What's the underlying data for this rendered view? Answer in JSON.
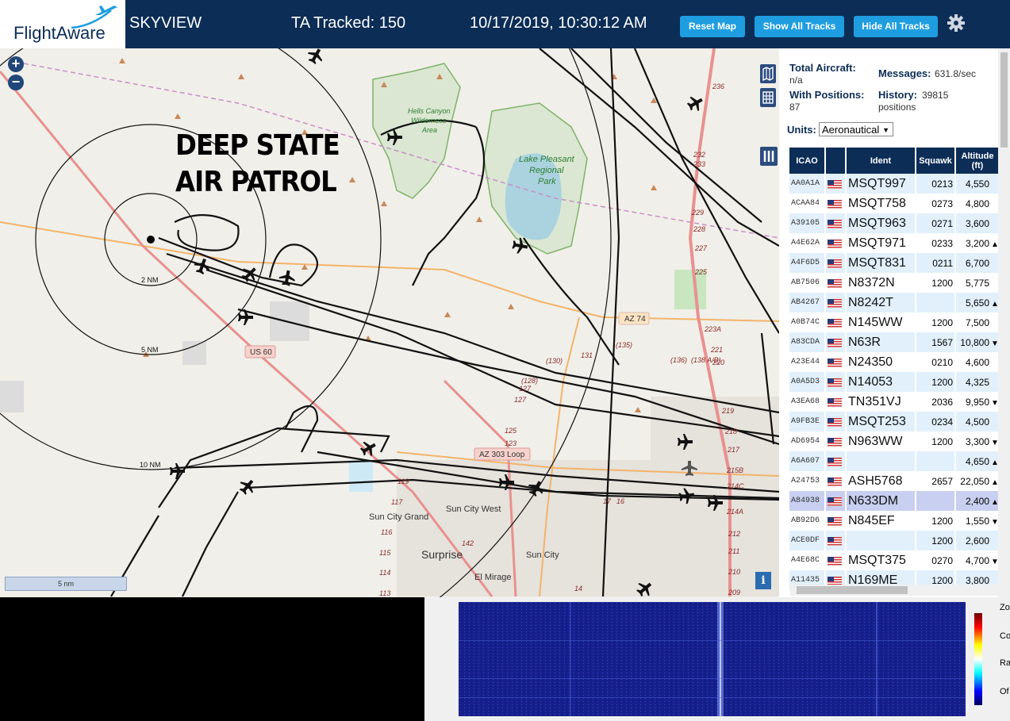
{
  "header": {
    "logo_text": "FlightAware",
    "app_title": "SKYVIEW",
    "ta_tracked": "TA Tracked: 150",
    "datetime": "10/17/2019, 10:30:12 AM",
    "reset_map_label": "Reset Map",
    "show_all_label": "Show All Tracks",
    "hide_all_label": "Hide All Tracks",
    "brand_color": "#0c2d56",
    "button_color": "#1e9ee0"
  },
  "map": {
    "overlay_line1": "DEEP STATE",
    "overlay_line2": "AIR PATROL",
    "zoom_in": "+",
    "zoom_out": "−",
    "scale_label": "5 nm",
    "info_label": "i",
    "range_rings": [
      "2 NM",
      "5 NM",
      "10 NM"
    ],
    "labels": {
      "hells_canyon": "Hells Canyon",
      "wilderness": "Wilderness",
      "area": "Area",
      "lake_pleasant": "Lake Pleasant",
      "regional": "Regional",
      "park": "Park",
      "us60": "US 60",
      "az74": "AZ 74",
      "az303": "AZ 303 Loop",
      "sun_city_west": "Sun City West",
      "sun_city_grand": "Sun City Grand",
      "surprise": "Surprise",
      "sun_city": "Sun City",
      "el_mirage": "El Mirage",
      "m236": "236",
      "m232": "232",
      "m233": "233",
      "m229": "229",
      "m228": "228",
      "m227": "227",
      "m225": "225",
      "m223a": "223A",
      "m221": "221",
      "m220": "220",
      "m219": "219",
      "m218": "218",
      "m217": "217",
      "m215b": "215B",
      "m214c": "214C",
      "m214a": "214A",
      "m212": "212",
      "m211": "211",
      "m210": "210",
      "m209": "209",
      "r130": "(130)",
      "r131": "131",
      "r135": "(135)",
      "r136": "(136)",
      "r138": "(138 A/B)",
      "r128": "(128)",
      "r127": "127",
      "r127b": "127",
      "r125": "125",
      "r123": "123",
      "r119": "119",
      "r117": "117",
      "r116": "116",
      "r115": "115",
      "r114": "114",
      "r113": "113",
      "r142": "142",
      "r14": "14",
      "r16": "16",
      "r17": "17"
    }
  },
  "stats": {
    "total_label": "Total Aircraft:",
    "total_value": "n/a",
    "positions_label": "With Positions:",
    "positions_value": "87",
    "messages_label": "Messages:",
    "messages_value": "631.8/sec",
    "history_label": "History:",
    "history_value": "39815",
    "history_unit": "positions",
    "units_label": "Units:",
    "units_value": "Aeronautical"
  },
  "table": {
    "headers": [
      "ICAO",
      "",
      "Ident",
      "Squawk",
      "Altitude (ft)"
    ],
    "rows": [
      {
        "icao": "AA0A1A",
        "ident": "MSQT997",
        "squawk": "0213",
        "alt": "4,550",
        "trend": ""
      },
      {
        "icao": "ACAA84",
        "ident": "MSQT758",
        "squawk": "0273",
        "alt": "4,800",
        "trend": ""
      },
      {
        "icao": "A39105",
        "ident": "MSQT963",
        "squawk": "0271",
        "alt": "3,600",
        "trend": ""
      },
      {
        "icao": "A4E62A",
        "ident": "MSQT971",
        "squawk": "0233",
        "alt": "3,200",
        "trend": "▲"
      },
      {
        "icao": "A4F6D5",
        "ident": "MSQT831",
        "squawk": "0211",
        "alt": "6,700",
        "trend": ""
      },
      {
        "icao": "AB7506",
        "ident": "N8372N",
        "squawk": "1200",
        "alt": "5,775",
        "trend": ""
      },
      {
        "icao": "AB4267",
        "ident": "N8242T",
        "squawk": "",
        "alt": "5,650",
        "trend": "▲"
      },
      {
        "icao": "A0B74C",
        "ident": "N145WW",
        "squawk": "1200",
        "alt": "7,500",
        "trend": ""
      },
      {
        "icao": "A83CDA",
        "ident": "N63R",
        "squawk": "1567",
        "alt": "10,800",
        "trend": "▼"
      },
      {
        "icao": "A23E44",
        "ident": "N24350",
        "squawk": "0210",
        "alt": "4,600",
        "trend": ""
      },
      {
        "icao": "A0A5D3",
        "ident": "N14053",
        "squawk": "1200",
        "alt": "4,325",
        "trend": ""
      },
      {
        "icao": "A3EA68",
        "ident": "TN351VJ",
        "squawk": "2036",
        "alt": "9,950",
        "trend": "▼"
      },
      {
        "icao": "A9FB3E",
        "ident": "MSQT253",
        "squawk": "0234",
        "alt": "4,500",
        "trend": ""
      },
      {
        "icao": "AD6954",
        "ident": "N963WW",
        "squawk": "1200",
        "alt": "3,300",
        "trend": "▼"
      },
      {
        "icao": "A6A607",
        "ident": "",
        "squawk": "",
        "alt": "4,650",
        "trend": "▲"
      },
      {
        "icao": "A24753",
        "ident": "ASH5768",
        "squawk": "2657",
        "alt": "22,050",
        "trend": "▲"
      },
      {
        "icao": "A84938",
        "ident": "N633DM",
        "squawk": "",
        "alt": "2,400",
        "trend": "▲"
      },
      {
        "icao": "AB92D6",
        "ident": "N845EF",
        "squawk": "1200",
        "alt": "1,550",
        "trend": "▼"
      },
      {
        "icao": "ACE0DF",
        "ident": "",
        "squawk": "1200",
        "alt": "2,600",
        "trend": ""
      },
      {
        "icao": "A4E68C",
        "ident": "MSQT375",
        "squawk": "0270",
        "alt": "4,700",
        "trend": "▼"
      },
      {
        "icao": "A11435",
        "ident": "N169ME",
        "squawk": "1200",
        "alt": "3,800",
        "trend": ""
      }
    ]
  },
  "waterfall": {
    "label_1": "Zo",
    "label_2": "Con",
    "label_3": "Ra",
    "label_4": "Of"
  }
}
